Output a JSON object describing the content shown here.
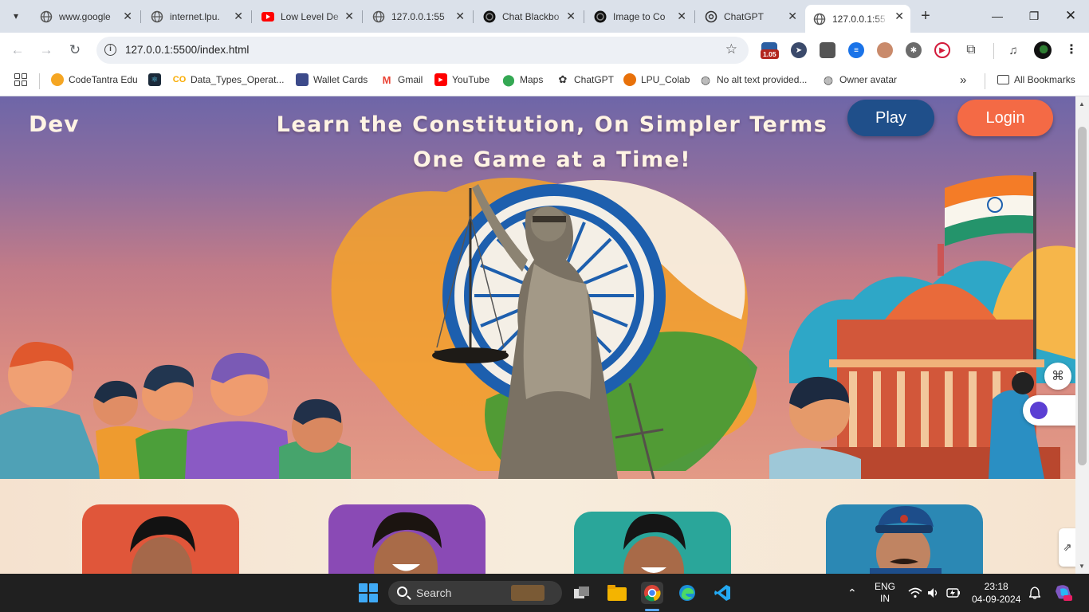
{
  "browser": {
    "tabs": [
      {
        "title": "www.google",
        "icon": "globe-icon"
      },
      {
        "title": "internet.lpu.",
        "icon": "globe-icon"
      },
      {
        "title": "Low Level De",
        "icon": "youtube-icon"
      },
      {
        "title": "127.0.0.1:55",
        "icon": "globe-icon"
      },
      {
        "title": "Chat Blackbo",
        "icon": "blackbox-icon"
      },
      {
        "title": "Image to Co",
        "icon": "blackbox-icon"
      },
      {
        "title": "ChatGPT",
        "icon": "chatgpt-icon"
      },
      {
        "title": "127.0.0.1:55",
        "icon": "globe-icon",
        "active": true
      }
    ],
    "url": "127.0.0.1:5500/index.html",
    "extension_badge": "1.05",
    "bookmarks": [
      {
        "label": "CodeTantra Edu",
        "icon": "codetantra-icon"
      },
      {
        "label": "",
        "icon": "react-icon"
      },
      {
        "label": "Data_Types_Operat...",
        "icon": "colab-icon"
      },
      {
        "label": "Wallet Cards",
        "icon": "wallet-icon"
      },
      {
        "label": "Gmail",
        "icon": "gmail-icon"
      },
      {
        "label": "YouTube",
        "icon": "youtube-icon"
      },
      {
        "label": "Maps",
        "icon": "maps-icon"
      },
      {
        "label": "ChatGPT",
        "icon": "chatgpt-icon"
      },
      {
        "label": "LPU_Colab",
        "icon": "lpu-icon"
      },
      {
        "label": "No alt text provided...",
        "icon": "globe-icon"
      },
      {
        "label": "Owner avatar",
        "icon": "globe-icon"
      }
    ],
    "more_bookmarks": "»",
    "all_bookmarks": "All Bookmarks"
  },
  "page": {
    "brand": "Dev",
    "tagline_line1": "Learn the Constitution, On Simpler Terms",
    "tagline_line2": "One Game at a Time!",
    "play_button": "Play",
    "login_button": "Login",
    "character_cards": [
      {
        "color": "#e0563a"
      },
      {
        "color": "#8a4ab5"
      },
      {
        "color": "#2aa69a"
      },
      {
        "color": "#2b88b4"
      }
    ]
  },
  "taskbar": {
    "search_label": "Search",
    "language_line1": "ENG",
    "language_line2": "IN",
    "time": "23:18",
    "date": "04-09-2024"
  }
}
